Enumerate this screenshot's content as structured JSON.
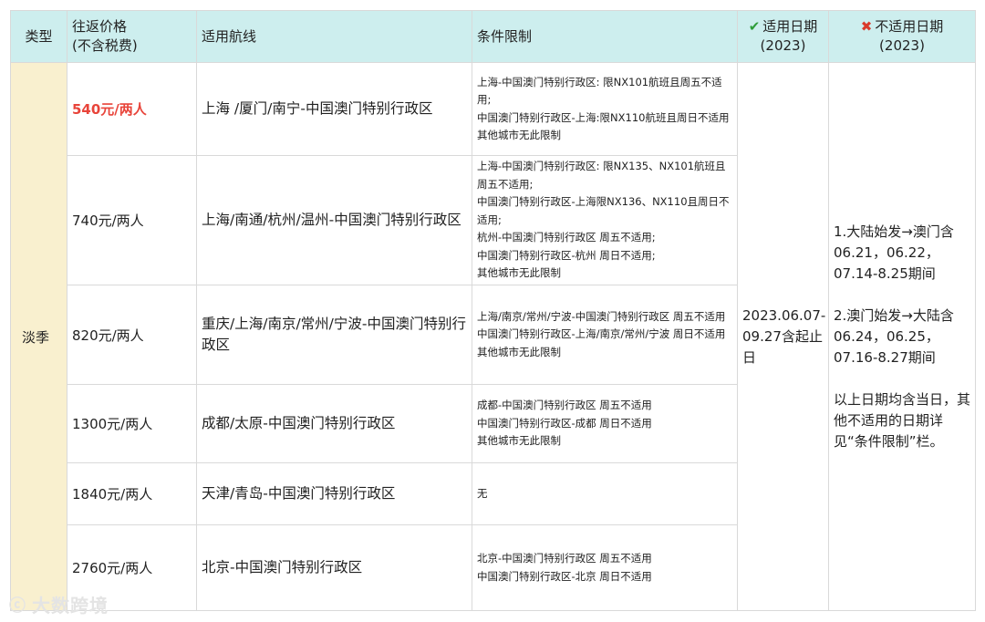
{
  "headers": {
    "type": "类型",
    "price_line1": "往返价格",
    "price_line2": "(不含税费)",
    "route": "适用航线",
    "condition": "条件限制",
    "valid_icon": "check-icon",
    "valid_line1": "适用日期",
    "valid_line2": "(2023)",
    "invalid_icon": "cross-icon",
    "invalid_line1": "不适用日期",
    "invalid_line2": "(2023)"
  },
  "type_value": "淡季",
  "rows": [
    {
      "price": "540元/两人",
      "route": "上海 /厦门/南宁-中国澳门特别行政区",
      "condition": "上海-中国澳门特别行政区: 限NX101航班且周五不适用;\n 中国澳门特别行政区-上海:限NX110航班且周日不适用\n 其他城市无此限制"
    },
    {
      "price": "740元/两人",
      "route": "上海/南通/杭州/温州-中国澳门特别行政区",
      "condition": "上海-中国澳门特别行政区: 限NX135、NX101航班且周五不适用;\n中国澳门特别行政区-上海限NX136、NX110且周日不适用;\n 杭州-中国澳门特别行政区 周五不适用;\n 中国澳门特别行政区-杭州 周日不适用;\n其他城市无此限制"
    },
    {
      "price": "820元/两人",
      "route": "重庆/上海/南京/常州/宁波-中国澳门特别行政区",
      "condition": "上海/南京/常州/宁波-中国澳门特别行政区 周五不适用\n中国澳门特别行政区-上海/南京/常州/宁波 周日不适用\n其他城市无此限制"
    },
    {
      "price": "1300元/两人",
      "route": "成都/太原-中国澳门特别行政区",
      "condition": "成都-中国澳门特别行政区 周五不适用\n中国澳门特别行政区-成都 周日不适用\n其他城市无此限制"
    },
    {
      "price": "1840元/两人",
      "route": "天津/青岛-中国澳门特别行政区",
      "condition": "无"
    },
    {
      "price": "2760元/两人",
      "route": "北京-中国澳门特别行政区",
      "condition": "北京-中国澳门特别行政区 周五不适用\n 中国澳门特别行政区-北京 周日不适用"
    }
  ],
  "valid_dates": "2023.06.07-09.27含起止日",
  "invalid_dates": "1.大陆始发→澳门含06.21，06.22，07.14-8.25期间\n\n2.澳门始发→大陆含06.24，06.25，07.16-8.27期间\n\n以上日期均含当日，其他不适用的日期详见“条件限制”栏。",
  "watermark": "大数跨境",
  "colors": {
    "header_bg": "#cdeeee",
    "type_bg": "#f9f0cf",
    "highlight_price": "#e8443a",
    "check": "#2e9d3a",
    "cross": "#d93a2b"
  }
}
